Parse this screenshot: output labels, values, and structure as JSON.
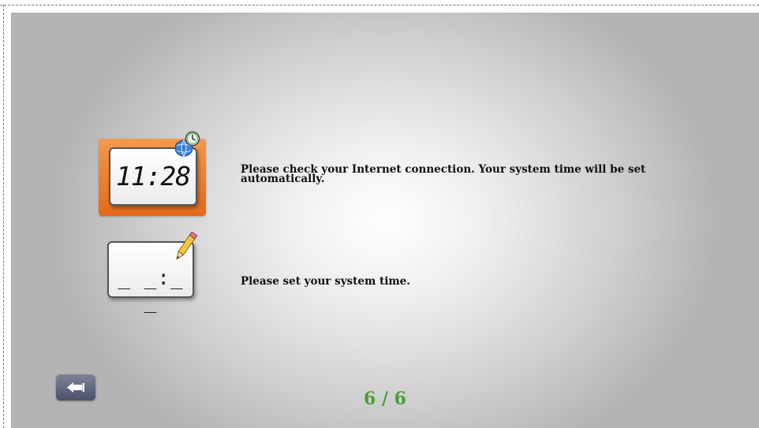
{
  "options": [
    {
      "id": "auto",
      "clock_display": "11:28",
      "description": "Please check your Internet connection. Your system time will be set automatically.",
      "selected": true,
      "icon": "globe-clock-icon"
    },
    {
      "id": "manual",
      "clock_display": "_ _:_ _",
      "description": "Please set your system time.",
      "selected": false,
      "icon": "pencil-icon"
    }
  ],
  "navigation": {
    "back_icon": "arrow-left-icon",
    "page_indicator": "6 / 6"
  },
  "colors": {
    "selected_tile": "#e9772a",
    "page_indicator": "#4f9b3a",
    "back_button": "#5a6078"
  }
}
